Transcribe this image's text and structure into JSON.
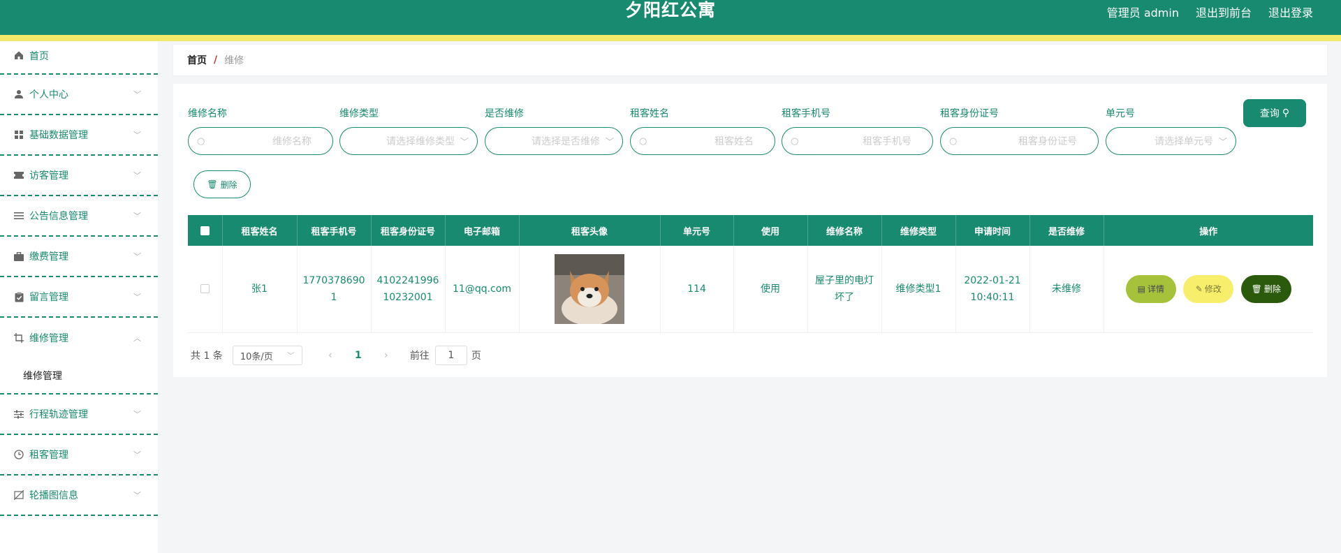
{
  "header": {
    "title": "夕阳红公寓",
    "links": [
      "管理员 admin",
      "退出到前台",
      "退出登录"
    ]
  },
  "sidebar": {
    "items": [
      {
        "label": "首页",
        "icon": "home-icon"
      },
      {
        "label": "个人中心",
        "icon": "user-icon"
      },
      {
        "label": "基础数据管理",
        "icon": "grid-icon"
      },
      {
        "label": "访客管理",
        "icon": "ticket-icon"
      },
      {
        "label": "公告信息管理",
        "icon": "list-icon"
      },
      {
        "label": "缴费管理",
        "icon": "briefcase-icon"
      },
      {
        "label": "留言管理",
        "icon": "clipboard-icon"
      },
      {
        "label": "维修管理",
        "icon": "crop-icon",
        "expanded": true,
        "sub": [
          "维修管理"
        ]
      },
      {
        "label": "行程轨迹管理",
        "icon": "sliders-icon"
      },
      {
        "label": "租客管理",
        "icon": "clock-icon"
      },
      {
        "label": "轮播图信息",
        "icon": "image-off-icon"
      }
    ]
  },
  "breadcrumb": {
    "home": "首页",
    "sep": "/",
    "current": "维修"
  },
  "filters": [
    {
      "label": "维修名称",
      "placeholder": "维修名称",
      "type": "input"
    },
    {
      "label": "维修类型",
      "placeholder": "请选择维修类型",
      "type": "select"
    },
    {
      "label": "是否维修",
      "placeholder": "请选择是否维修",
      "type": "select"
    },
    {
      "label": "租客姓名",
      "placeholder": "租客姓名",
      "type": "input"
    },
    {
      "label": "租客手机号",
      "placeholder": "租客手机号",
      "type": "input"
    },
    {
      "label": "租客身份证号",
      "placeholder": "租客身份证号",
      "type": "input"
    },
    {
      "label": "单元号",
      "placeholder": "请选择单元号",
      "type": "select"
    }
  ],
  "actions": {
    "query": "查询",
    "delete": "删除"
  },
  "table": {
    "columns": [
      "租客姓名",
      "租客手机号",
      "租客身份证号",
      "电子邮箱",
      "租客头像",
      "单元号",
      "使用",
      "维修名称",
      "维修类型",
      "申请时间",
      "是否维修",
      "操作"
    ],
    "rows": [
      {
        "name": "张1",
        "phone_a": "1770378690",
        "phone_b": "1",
        "idcard_a": "4102241996",
        "idcard_b": "10232001",
        "email": "11@qq.com",
        "unit": "114",
        "use": "使用",
        "repair_name_a": "屋子里的电灯",
        "repair_name_b": "坏了",
        "repair_type": "维修类型1",
        "date": "2022-01-21",
        "time": "10:40:11",
        "status": "未维修"
      }
    ],
    "row_actions": {
      "detail": "详情",
      "edit": "修改",
      "delete": "删除"
    }
  },
  "pagination": {
    "total": "共 1 条",
    "page_size": "10条/页",
    "current": "1",
    "goto_prefix": "前往",
    "goto_value": "1",
    "goto_suffix": "页"
  },
  "colors": {
    "primary": "#178a6f",
    "stripe": "#f2e86a",
    "detail": "#a6c23a",
    "edit": "#f7ee6b",
    "delete": "#2c5a0c"
  }
}
